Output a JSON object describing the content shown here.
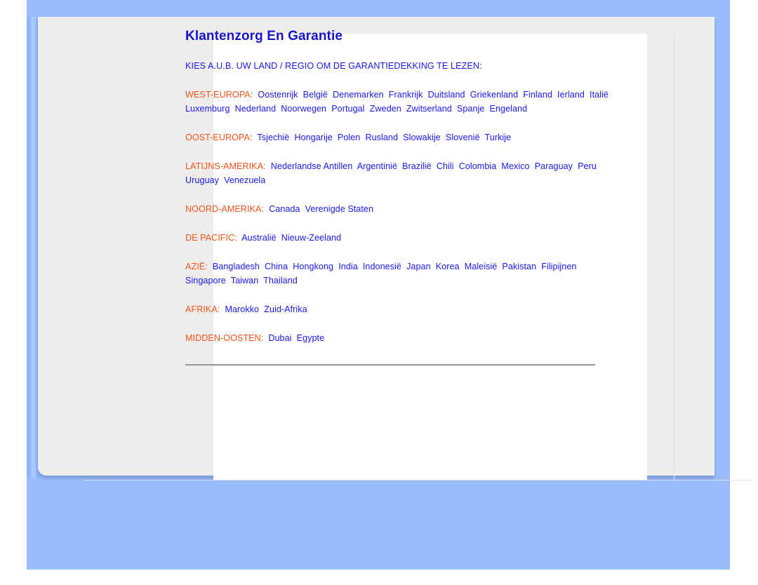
{
  "page": {
    "title": "Klantenzorg En Garantie",
    "intro": "KIES A.U.B. UW LAND / REGIO OM DE GARANTIEDEKKING TE LEZEN:",
    "colors": {
      "heading": "#1414cf",
      "link": "#1a1aee",
      "region_label": "#f4541a",
      "backdrop_blue": "#99bcfb",
      "card_gray": "#eeedec",
      "sheet_white": "#ffffff",
      "divider_gray": "#9b9b9b"
    }
  },
  "regions": [
    {
      "label": "WEST-EUROPA:",
      "countries": [
        "Oostenrijk",
        "België",
        "Denemarken",
        "Frankrijk",
        "Duitsland",
        "Griekenland",
        "Finland",
        "Ierland",
        "Italië",
        "Luxemburg",
        "Nederland",
        "Noorwegen",
        "Portugal",
        "Zweden",
        "Zwitserland",
        "Spanje",
        "Engeland"
      ]
    },
    {
      "label": "OOST-EUROPA:",
      "countries": [
        "Tsjechië",
        "Hongarije",
        "Polen",
        "Rusland",
        "Slowakije",
        "Slovenië",
        "Turkije"
      ]
    },
    {
      "label": "LATIJNS-AMERIKA:",
      "countries": [
        "Nederlandse Antillen",
        "Argentinië",
        "Brazilië",
        "Chili",
        "Colombia",
        "Mexico",
        "Paraguay",
        "Peru",
        "Uruguay",
        "Venezuela"
      ]
    },
    {
      "label": "NOORD-AMERIKA:",
      "countries": [
        "Canada",
        "Verenigde Staten"
      ]
    },
    {
      "label": "DE PACIFIC:",
      "countries": [
        "Australië",
        "Nieuw-Zeeland"
      ]
    },
    {
      "label": "AZIË:",
      "countries": [
        "Bangladesh",
        "China",
        "Hongkong",
        "India",
        "Indonesië",
        "Japan",
        "Korea",
        "Maleisië",
        "Pakistan",
        "Filipijnen",
        "Singapore",
        "Taiwan",
        "Thailand"
      ]
    },
    {
      "label": "AFRIKA:",
      "countries": [
        "Marokko",
        "Zuid-Afrika"
      ]
    },
    {
      "label": "MIDDEN-OOSTEN:",
      "countries": [
        "Dubai",
        "Egypte"
      ]
    }
  ]
}
